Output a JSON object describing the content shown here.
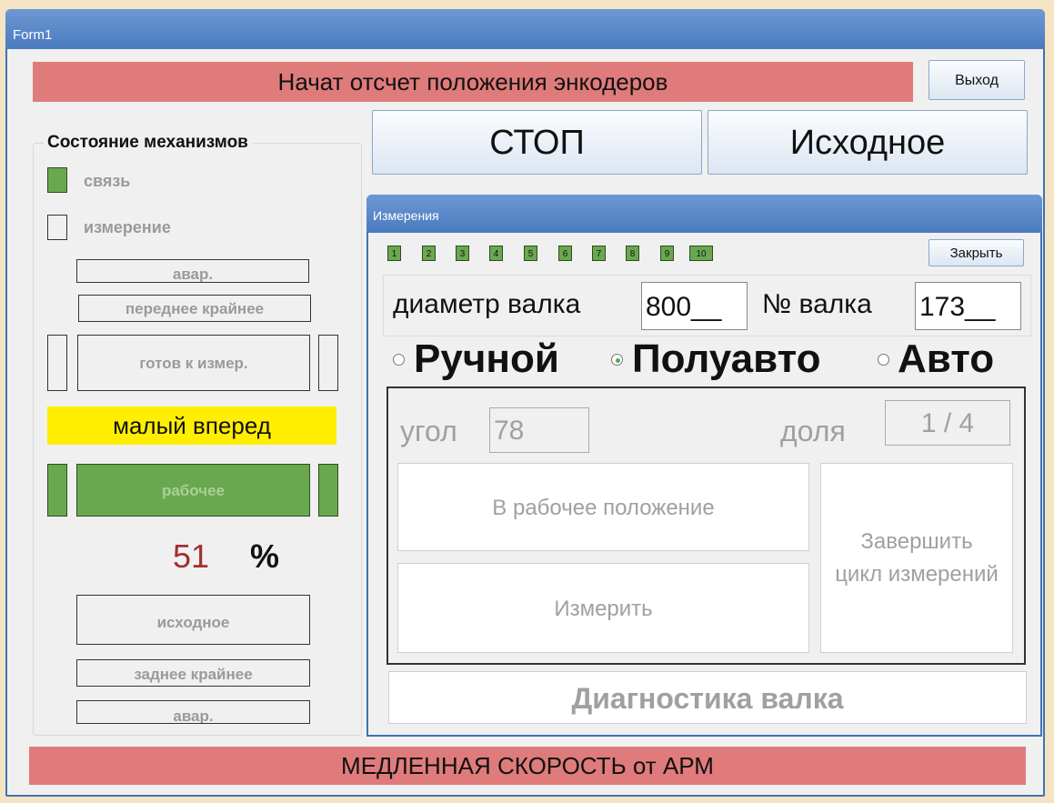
{
  "window": {
    "title": "Form1"
  },
  "top_status": "Начат отсчет положения энкодеров",
  "exit_button": "Выход",
  "stop_button": "СТОП",
  "home_button": "Исходное",
  "left": {
    "group_title": "Состояние механизмов",
    "svyaz": "связь",
    "izmerenie": "измерение",
    "avar_top": "авар.",
    "front_limit": "переднее крайнее",
    "ready": "готов к измер.",
    "slow_forward": "малый вперед",
    "working": "рабочее",
    "percent_value": "51",
    "percent_sign": "%",
    "home_state": "исходное",
    "rear_limit": "заднее крайнее",
    "avar_bottom": "авар."
  },
  "measure": {
    "title": "Измерения",
    "numbers": [
      "1",
      "2",
      "3",
      "4",
      "5",
      "6",
      "7",
      "8",
      "9",
      "10"
    ],
    "close_button": "Закрыть",
    "diameter_label": "диаметр валка",
    "diameter_value": "800__",
    "roll_no_label": "№ валка",
    "roll_no_value": "173__",
    "mode_manual": "Ручной",
    "mode_semi": "Полуавто",
    "mode_auto": "Авто",
    "angle_label": "угол",
    "angle_value": "78",
    "share_label": "доля",
    "share_value": "1 / 4",
    "to_work_button": "В рабочее положение",
    "measure_button": "Измерить",
    "finish_cycle_button": "Завершить цикл измерений",
    "diagnostics_button": "Диагностика валка"
  },
  "bottom_status": "МЕДЛЕННАЯ СКОРОСТЬ от АРМ",
  "colors": {
    "status_red": "#e07b7b",
    "indicator_green": "#6aa84f",
    "highlight_yellow": "#ffee00",
    "percent_red": "#a03030",
    "title_blue": "#4a7bc0"
  }
}
